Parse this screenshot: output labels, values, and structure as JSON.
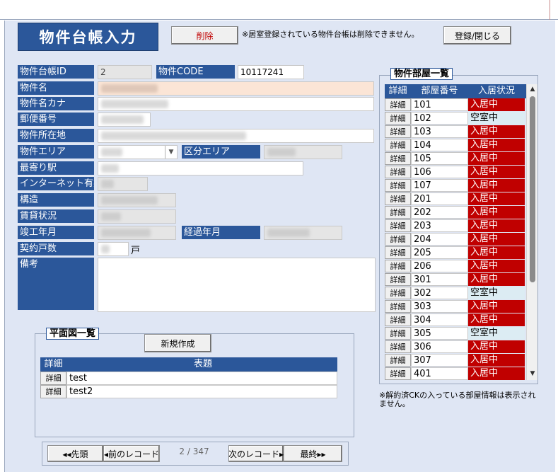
{
  "form": {
    "title": "物件台帳入力",
    "delete_label": "削除",
    "delete_note": "※居室登録されている物件台帳は削除できません。",
    "register_close_label": "登録/閉じる"
  },
  "fields": {
    "property_id_label": "物件台帳ID",
    "property_id_value": "2",
    "property_code_label": "物件CODE",
    "property_code_value": "10117241",
    "property_name_label": "物件名",
    "property_kana_label": "物件名カナ",
    "postal_code_label": "郵便番号",
    "address_label": "物件所在地",
    "area_label": "物件エリア",
    "division_area_label": "区分エリア",
    "nearest_station_label": "最寄り駅",
    "internet_label": "インターネット有無",
    "structure_label": "構造",
    "rental_status_label": "賃貸状況",
    "completion_label": "竣工年月",
    "elapsed_label": "経過年月",
    "units_label": "契約戸数",
    "units_suffix": "戸",
    "remarks_label": "備考"
  },
  "rooms": {
    "title": "物件部屋一覧",
    "columns": [
      "詳細",
      "部屋番号",
      "入居状況"
    ],
    "detail_label": "詳細",
    "rows": [
      {
        "room": "101",
        "status": "入居中"
      },
      {
        "room": "102",
        "status": "空室中"
      },
      {
        "room": "103",
        "status": "入居中"
      },
      {
        "room": "104",
        "status": "入居中"
      },
      {
        "room": "105",
        "status": "入居中"
      },
      {
        "room": "106",
        "status": "入居中"
      },
      {
        "room": "107",
        "status": "入居中"
      },
      {
        "room": "201",
        "status": "入居中"
      },
      {
        "room": "202",
        "status": "入居中"
      },
      {
        "room": "203",
        "status": "入居中"
      },
      {
        "room": "204",
        "status": "入居中"
      },
      {
        "room": "205",
        "status": "入居中"
      },
      {
        "room": "206",
        "status": "入居中"
      },
      {
        "room": "301",
        "status": "入居中"
      },
      {
        "room": "302",
        "status": "空室中"
      },
      {
        "room": "303",
        "status": "入居中"
      },
      {
        "room": "304",
        "status": "入居中"
      },
      {
        "room": "305",
        "status": "空室中"
      },
      {
        "room": "306",
        "status": "入居中"
      },
      {
        "room": "307",
        "status": "入居中"
      },
      {
        "room": "401",
        "status": "入居中"
      }
    ],
    "note": "※解約済CKの入っている部屋情報は表示されません。"
  },
  "floor_plans": {
    "title": "平面図一覧",
    "new_label": "新規作成",
    "columns": [
      "詳細",
      "表題"
    ],
    "detail_label": "詳細",
    "rows": [
      "test",
      "test2"
    ]
  },
  "navigation": {
    "first_label": "◂◂先頭",
    "prev_label": "◂前のレコード",
    "position": "2 / 347",
    "next_label": "次のレコード▸",
    "last_label": "最終▸▸"
  },
  "icons": {
    "combo": "chevron-down-icon",
    "scroll_up": "triangle-up-icon",
    "scroll_down": "triangle-down-icon"
  },
  "colors": {
    "header_blue": "#2b579a",
    "occupied_red": "#c00000",
    "vacant_blue": "#dcecf3",
    "form_bg": "#dfe6f4"
  }
}
